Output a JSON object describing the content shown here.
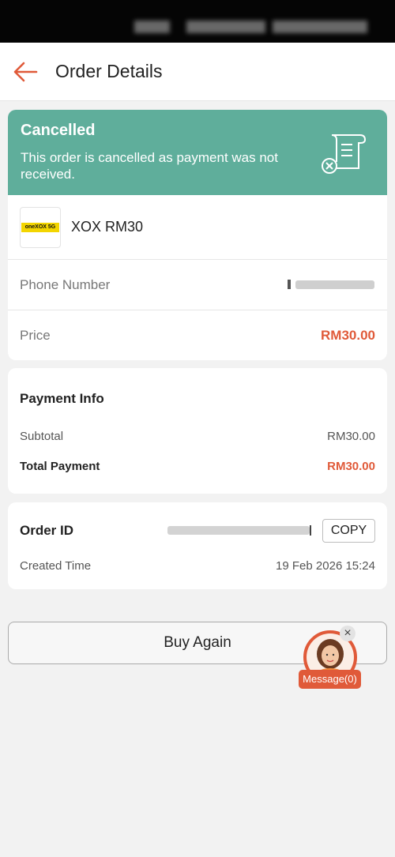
{
  "header": {
    "title": "Order Details",
    "back_icon": "arrow-left-icon",
    "accent_color": "#e05a39"
  },
  "status": {
    "title": "Cancelled",
    "description": "This order is cancelled as payment was not received.",
    "icon": "receipt-cancel-icon",
    "color": "#5fae9b"
  },
  "product": {
    "logo_text": "oneXOX 5G",
    "name": "XOX RM30"
  },
  "details": {
    "phone_label": "Phone Number",
    "price_label": "Price",
    "price_value": "RM30.00"
  },
  "payment": {
    "title": "Payment Info",
    "subtotal_label": "Subtotal",
    "subtotal_value": "RM30.00",
    "total_label": "Total Payment",
    "total_value": "RM30.00"
  },
  "order": {
    "id_label": "Order ID",
    "copy_label": "COPY",
    "created_label": "Created Time",
    "created_value": "19 Feb 2026 15:24"
  },
  "actions": {
    "buy_again_label": "Buy Again"
  },
  "chat": {
    "label": "Message(0)",
    "close_icon": "close-icon"
  }
}
